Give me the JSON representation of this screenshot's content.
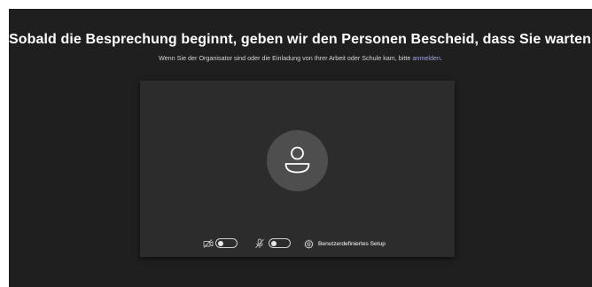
{
  "prejoin": {
    "heading": "Sobald die Besprechung beginnt, geben wir den Personen Bescheid, dass Sie warten.",
    "subtext": "Wenn Sie der Organisator sind oder die Einladung von Ihrer Arbeit oder Schule kam, bitte ",
    "signin_link": "anmelden",
    "subtext_end": "."
  },
  "controls": {
    "camera": {
      "icon": "camera-off-icon",
      "enabled": false
    },
    "microphone": {
      "icon": "mic-off-icon",
      "enabled": false
    },
    "setup": {
      "icon": "gear-icon",
      "label": "Benutzerdefiniertes Setup"
    }
  },
  "colors": {
    "background": "#1f1f1f",
    "preview": "#2d2c2c",
    "avatar": "#4f4e4e",
    "link": "#a6a7dc"
  }
}
